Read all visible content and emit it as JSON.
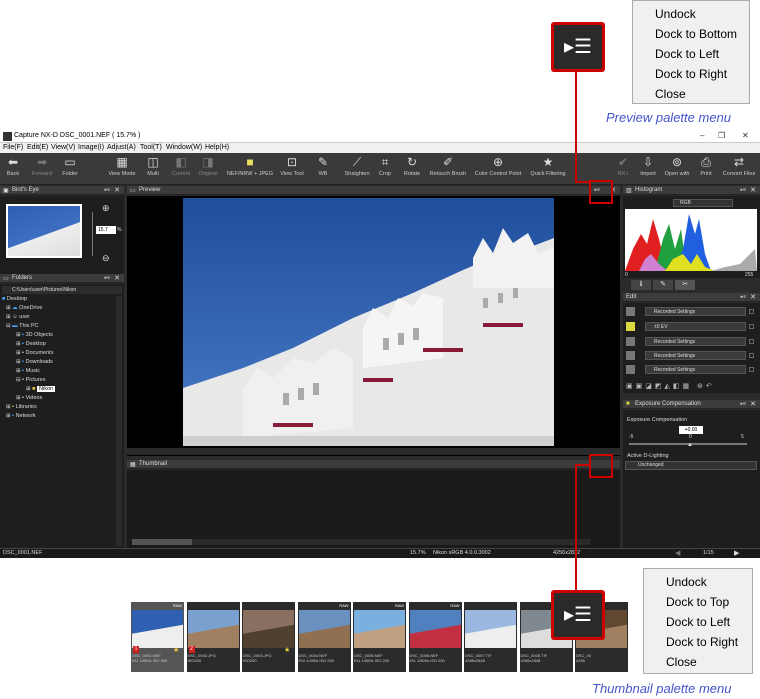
{
  "window": {
    "title": "Capture NX-D    DSC_0001.NEF ( 15.7% )",
    "controls": [
      "–",
      "❐",
      "✕"
    ]
  },
  "menubar": [
    "File(F)",
    "Edit(E)",
    "View(V)",
    "Image(I)",
    "Adjust(A)",
    "Tool(T)",
    "Window(W)",
    "Help(H)"
  ],
  "toolbar": {
    "back": "Back",
    "forward": "Forward",
    "folder": "Folder",
    "view_mode": "View Mode",
    "multi": "Multi",
    "current": "Current",
    "original": "Original",
    "nef_jpeg": "NEF/NRW + JPEG",
    "view_tool": "View Tool",
    "wb": "WB",
    "straighten": "Straighten",
    "crop": "Crop",
    "rotate": "Rotate",
    "retouch": "Retouch Brush",
    "ccp": "Color Control Point",
    "quick_filter": "Quick Filtering",
    "nx_i": "NX-i",
    "import": "Import",
    "open_with": "Open with",
    "print": "Print",
    "convert": "Convert Files"
  },
  "birds_eye": {
    "title": "Bird's Eye",
    "zoom": "15.7",
    "unit": "%"
  },
  "folders": {
    "title": "Folders",
    "path": "C:\\Users\\user\\Pictures\\Nikon",
    "items": [
      "Desktop",
      "OneDrive",
      "user",
      "This PC",
      "3D Objects",
      "Desktop",
      "Documents",
      "Downloads",
      "Music",
      "Pictures",
      "Nikon",
      "Videos",
      "Libraries",
      "Network"
    ]
  },
  "preview": {
    "title": "Preview"
  },
  "thumbnail": {
    "title": "Thumbnail",
    "items": [
      {
        "name": "DSC_0001.NEF",
        "info": "f/11 1/500s ISO 200",
        "raw": "RAW",
        "label": "1",
        "star": true
      },
      {
        "name": "DSC_0002.JPG",
        "info": "ISO200",
        "raw": "",
        "label": "2",
        "star": false
      },
      {
        "name": "DSC_0003.JPG",
        "info": "ISO200",
        "raw": "",
        "label": "",
        "star": true
      },
      {
        "name": "DSC_0004.NEF",
        "info": "f/10 1/400s ISO 200",
        "raw": "RAW",
        "label": "",
        "star": false
      },
      {
        "name": "DSC_0005.NEF",
        "info": "f/11 1/500s ISO 200",
        "raw": "RAW",
        "label": "",
        "star": false
      },
      {
        "name": "DSC_0006.NEF",
        "info": "f/11 1/500s ISO 200",
        "raw": "RAW",
        "label": "",
        "star": false
      },
      {
        "name": "DSC_0007.TIF",
        "info": "4288x2848",
        "raw": "",
        "label": "",
        "star": false
      },
      {
        "name": "DSC_0008.TIF",
        "info": "4288x2848",
        "raw": "",
        "label": "",
        "star": false
      },
      {
        "name": "DSC_00",
        "info": "4256",
        "raw": "",
        "label": "",
        "star": false
      }
    ]
  },
  "histogram": {
    "title": "Histogram",
    "channel": "RGB",
    "min": "0",
    "max": "255"
  },
  "edit": {
    "title": "Edit",
    "rows": [
      "Recorded Settings",
      "±0 EV",
      "Recorded Settings",
      "Recorded Settings",
      "Recorded Settings"
    ]
  },
  "exposure": {
    "title": "Exposure Compensation",
    "label": "Exposure Compensation",
    "value": "+0.00",
    "min": "-5",
    "zero": "0",
    "max": "5",
    "adl_label": "Active D-Lighting",
    "adl_value": "Unchanged"
  },
  "statusbar": {
    "file": "DSC_0001.NEF",
    "zoom": "15.7%",
    "profile": "Nikon sRGB 4.0.0.3002",
    "size": "4256x2832",
    "page": "1/15"
  },
  "preview_menu": {
    "items": [
      "Undock",
      "Dock to Bottom",
      "Dock to Left",
      "Dock to Right",
      "Close"
    ],
    "caption": "Preview palette menu"
  },
  "thumbnail_menu": {
    "items": [
      "Undock",
      "Dock to Top",
      "Dock to Left",
      "Dock to Right",
      "Close"
    ],
    "caption": "Thumbnail palette menu"
  },
  "colors": {
    "accent_red": "#cc0000",
    "caption_blue": "#4455cc",
    "sky": "#2f5fb0"
  }
}
